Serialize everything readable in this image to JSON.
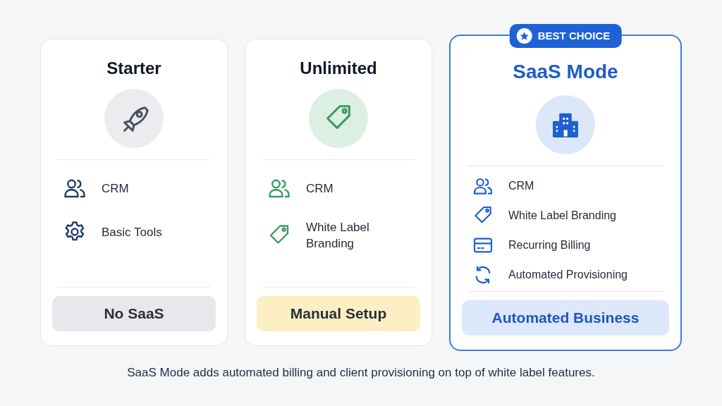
{
  "plans": [
    {
      "name": "Starter",
      "kind": "basic",
      "featured": false,
      "features": [
        {
          "kind": "people",
          "text": "CRM"
        },
        {
          "kind": "settings",
          "text": "Basic Tools"
        }
      ],
      "tag": "No SaaS"
    },
    {
      "name": "Unlimited",
      "kind": "brand",
      "featured": false,
      "features": [
        {
          "kind": "people",
          "text": "CRM"
        },
        {
          "kind": "label",
          "text": "White Label Branding"
        }
      ],
      "tag": "Manual Setup"
    },
    {
      "name": "SaaS Mode",
      "kind": "business",
      "featured": true,
      "badge": "BEST CHOICE",
      "features": [
        {
          "kind": "people",
          "text": "CRM"
        },
        {
          "kind": "label",
          "text": "White Label Branding"
        },
        {
          "kind": "billing",
          "text": "Recurring Billing"
        },
        {
          "kind": "refresh",
          "text": "Automated Provisioning"
        }
      ],
      "tag": "Automated Business"
    }
  ],
  "caption": "SaaS Mode adds automated billing and client provisioning on top of white label features."
}
